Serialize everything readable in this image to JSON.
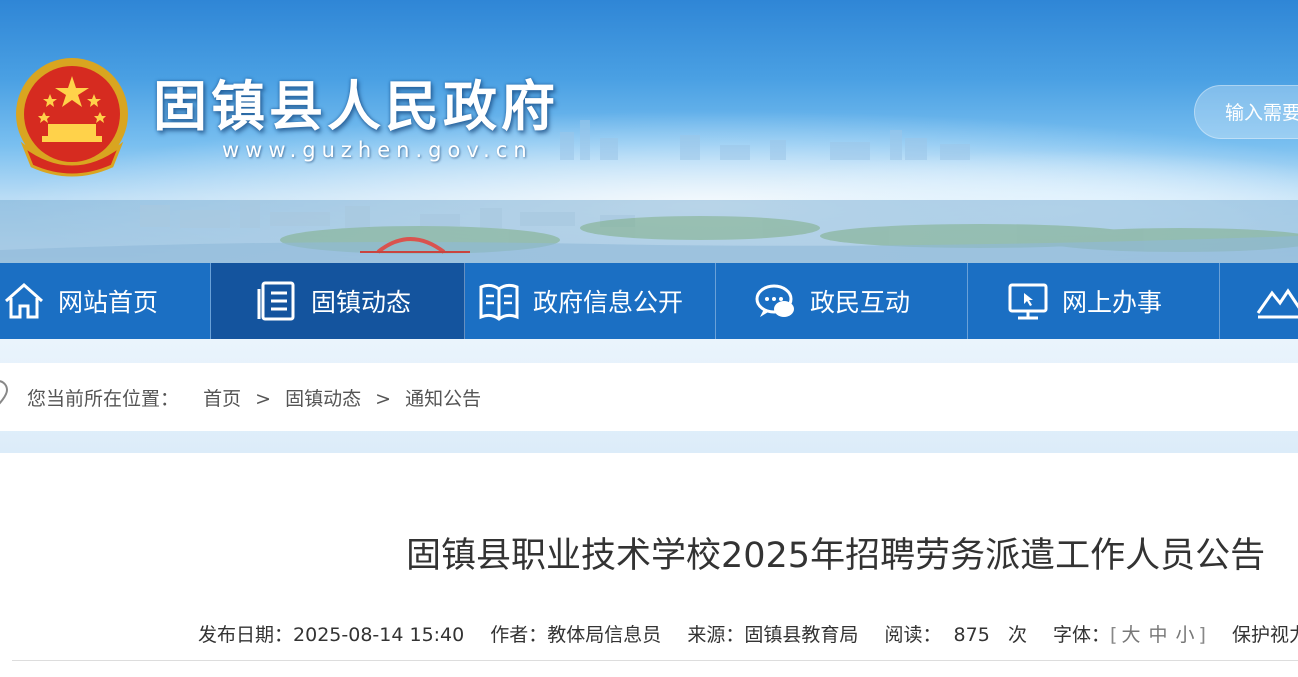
{
  "header": {
    "site_name": "固镇县人民政府",
    "site_url": "www.guzhen.gov.cn",
    "search_placeholder": "输入需要"
  },
  "nav": {
    "items": [
      {
        "label": "网站首页",
        "icon": "home-icon"
      },
      {
        "label": "固镇动态",
        "icon": "document-list-icon",
        "active": true
      },
      {
        "label": "政府信息公开",
        "icon": "book-icon"
      },
      {
        "label": "政民互动",
        "icon": "chat-icon"
      },
      {
        "label": "网上办事",
        "icon": "computer-monitor-icon"
      },
      {
        "label": "",
        "icon": "mountain-icon"
      }
    ]
  },
  "breadcrumb": {
    "lead": "您当前所在位置：",
    "items": [
      "首页",
      "固镇动态",
      "通知公告"
    ],
    "separator": ">"
  },
  "article": {
    "title": "固镇县职业技术学校2025年招聘劳务派遣工作人员公告",
    "meta": {
      "date_label": "发布日期：",
      "date": "2025-08-14 15:40",
      "author_label": "作者：",
      "author": "教体局信息员",
      "source_label": "来源：",
      "source": "固镇县教育局",
      "views_label": "阅读：",
      "views": "875",
      "views_unit": "次",
      "font_label": "字体：",
      "font_open": "[",
      "font_large": "大",
      "font_medium": "中",
      "font_small": "小",
      "font_close": "]",
      "eye_care_label": "保护视力色："
    }
  },
  "colors": {
    "nav_bg": "#1b6fc3",
    "nav_active": "#14549e",
    "banner_sky": "#4aa0e3"
  }
}
